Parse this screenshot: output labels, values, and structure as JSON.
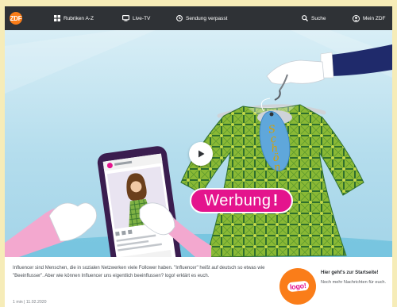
{
  "nav": {
    "logo": "ZDF",
    "items": [
      {
        "label": "Rubriken A-Z",
        "icon": "grid-icon"
      },
      {
        "label": "Live-TV",
        "icon": "tv-icon"
      },
      {
        "label": "Sendung verpasst",
        "icon": "clock-icon"
      },
      {
        "label": "Suche",
        "icon": "search-icon"
      },
      {
        "label": "Mein ZDF",
        "icon": "user-icon"
      }
    ]
  },
  "hero": {
    "badge_text": "Werbung",
    "badge_excl": "!",
    "tag_letters": [
      "S",
      "c",
      "h",
      "ö",
      "n"
    ]
  },
  "teaser": {
    "text": "Influencer sind Menschen, die in sozialen Netzwerken viele Follower haben. \"Influencer\" heißt auf deutsch so etwas wie \"Beeinflusser\". Aber wie können Influencer uns eigentlich beeinflussen? logo! erklärt es euch.",
    "meta": "1 min | 11.02.2020"
  },
  "promo": {
    "logo_text": "logo!",
    "title": "Hier geht's zur Startseite!",
    "subtitle": "Noch mehr Nachrichten für euch."
  },
  "colors": {
    "navbar": "#2f3236",
    "zdf_orange": "#fa7d19",
    "pink": "#e4148d",
    "dress_green": "#8ab935",
    "sky": "#b4dded"
  }
}
